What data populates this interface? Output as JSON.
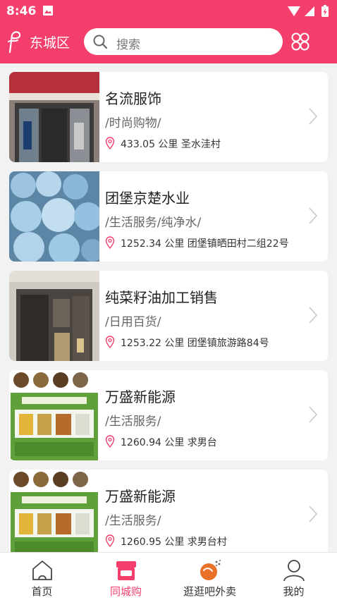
{
  "status_bar": {
    "time": "8:46"
  },
  "header": {
    "location": "东城区",
    "search_placeholder": "搜索",
    "accent_color": "#f43e6c"
  },
  "stores": [
    {
      "name": "名流服饰",
      "category": "/时尚购物/",
      "distance": "433.05 公里",
      "address": "圣水洼村",
      "image": "clothing-store-photo"
    },
    {
      "name": "团堡京楚水业",
      "category": "/生活服务/纯净水/",
      "distance": "1252.34 公里",
      "address": "团堡镇晒田村二组22号",
      "image": "water-bottles-photo"
    },
    {
      "name": "纯菜籽油加工销售",
      "category": "/日用百货/",
      "distance": "1253.22 公里",
      "address": "团堡镇旅游路84号",
      "image": "oil-shop-photo"
    },
    {
      "name": "万盛新能源",
      "category": "/生活服务/",
      "distance": "1260.94 公里",
      "address": "求男台",
      "image": "fuel-poster"
    },
    {
      "name": "万盛新能源",
      "category": "/生活服务/",
      "distance": "1260.95 公里",
      "address": "求男台村",
      "image": "fuel-poster"
    }
  ],
  "tabs": [
    {
      "label": "首页",
      "icon": "home-icon",
      "active": false
    },
    {
      "label": "同城购",
      "icon": "shop-icon",
      "active": true
    },
    {
      "label": "逛逛吧外卖",
      "icon": "takeout-icon",
      "active": false
    },
    {
      "label": "我的",
      "icon": "profile-icon",
      "active": false
    }
  ]
}
